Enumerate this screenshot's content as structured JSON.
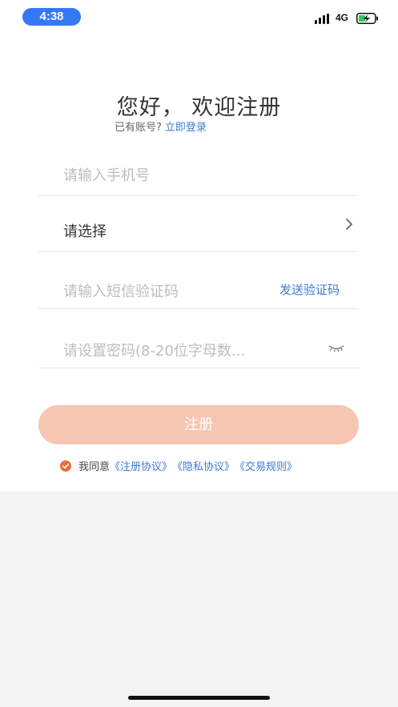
{
  "status_bar": {
    "time": "4:38",
    "network": "4G"
  },
  "header": {
    "title": "您好， 欢迎注册",
    "has_account_text": "已有账号?",
    "login_link": "立即登录"
  },
  "form": {
    "phone_placeholder": "请输入手机号",
    "select_value": "请选择",
    "sms_placeholder": "请输入短信验证码",
    "send_code_label": "发送验证码",
    "password_placeholder": "请设置密码(8-20位字母数..."
  },
  "register_button": "注册",
  "agreement": {
    "prefix": "我同意",
    "register_protocol": "《注册协议》",
    "privacy_protocol": "《隐私协议》",
    "trade_rules": "《交易规则》"
  },
  "colors": {
    "accent_blue": "#3b7ad9",
    "button_bg": "#f5c6b1",
    "check_orange": "#e8703c"
  }
}
